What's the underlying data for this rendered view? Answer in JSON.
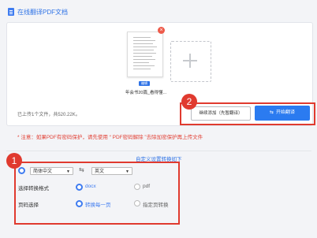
{
  "header": {
    "title": "在线翻译PDF文档"
  },
  "file": {
    "remove_label": "×",
    "tag": "编辑",
    "name": "年会书20篇_看得懂..."
  },
  "upload": {
    "info": "已上传1个文件，共520.22K。"
  },
  "buttons": {
    "continue_label": "继续添加（先暂翻译）",
    "start_label": "开始翻译",
    "start_icon": "⇆"
  },
  "annotations": {
    "badge1": "1",
    "badge2": "2",
    "badge_color": "#e03a2f"
  },
  "notice": "* 注意：如果PDF有密码保护，请先使用 “ PDF密码解除 ”去除加密保护再上传文件",
  "custom_link": "自定义设置转换如下",
  "language": {
    "source": "简体中文",
    "target": "英文",
    "swap_icon": "⇆"
  },
  "format": {
    "label": "选择转换格式",
    "option1": "docx",
    "option2": "pdf"
  },
  "pages": {
    "label": "页码选择",
    "option1": "转换每一页",
    "option2": "指定页转换"
  },
  "colors": {
    "accent": "#2f73e6",
    "danger": "#e03a2f"
  }
}
